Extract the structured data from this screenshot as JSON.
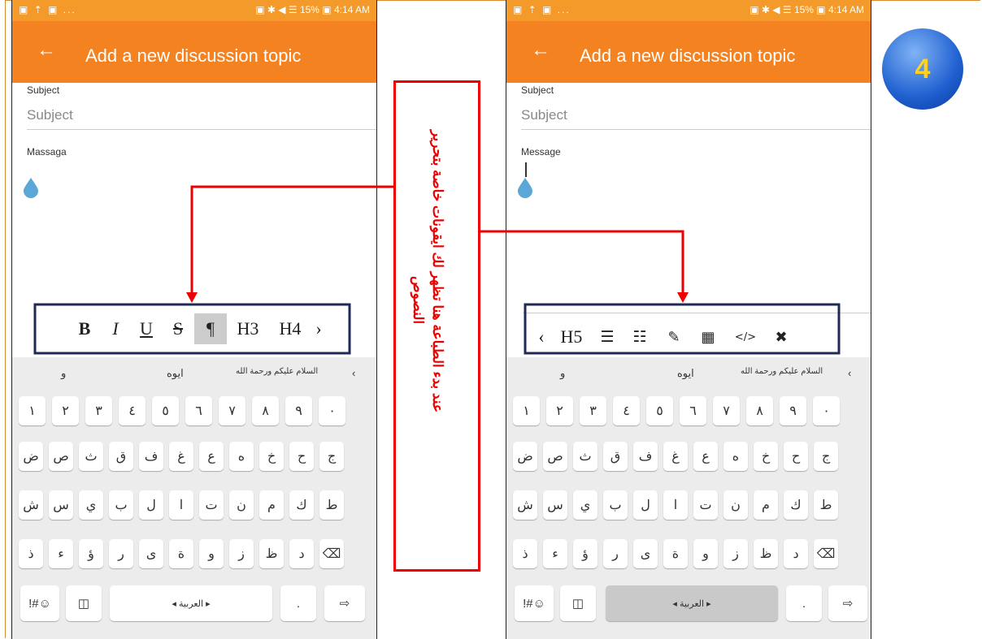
{
  "status_bar": {
    "left_icons": "▣ ⇡ ▣ ...",
    "right_info": "▣ ✱ ◀ ☰ 15% ▣ 4:14 AM"
  },
  "app_bar": {
    "back_icon": "←",
    "title": "Add a new discussion topic"
  },
  "form": {
    "subject_label": "Subject",
    "subject_placeholder": "Subject",
    "message_label_left": "Massaga",
    "message_label_right": "Message"
  },
  "toolbar_left": {
    "buttons": [
      "B",
      "I",
      "U",
      "S",
      "¶",
      "H3",
      "H4"
    ],
    "active_index": 4,
    "more": "›"
  },
  "toolbar_right": {
    "less": "‹",
    "buttons": [
      "H5",
      "☰",
      "☷",
      "✎",
      "▦",
      "</>",
      "✖"
    ]
  },
  "keyboard": {
    "suggestions": [
      "و",
      "ايوه",
      "السلام عليكم ورحمة الله",
      "‹"
    ],
    "digits": [
      "١",
      "٢",
      "٣",
      "٤",
      "٥",
      "٦",
      "٧",
      "٨",
      "٩",
      "٠"
    ],
    "row1": [
      "ض",
      "ص",
      "ث",
      "ق",
      "ف",
      "غ",
      "ع",
      "ه",
      "خ",
      "ح",
      "ج"
    ],
    "row2": [
      "ش",
      "س",
      "ي",
      "ب",
      "ل",
      "ا",
      "ت",
      "ن",
      "م",
      "ك",
      "ط"
    ],
    "row3": [
      "ذ",
      "ء",
      "ؤ",
      "ر",
      "ى",
      "ة",
      "و",
      "ز",
      "ظ",
      "د",
      "⌫"
    ],
    "symbols_key": "!#☺",
    "space_label": "◂ العربية ▸",
    "period_key": ".",
    "enter_key": "⇨"
  },
  "callout": {
    "line1": "عند بدء الطباعة هنا تظهر لك ايقونات خاصة بتحرير",
    "line2": "النصوص"
  },
  "step_badge": "4",
  "colors": {
    "app_bar": "#f58220",
    "status_bar": "#f39a2b",
    "callout": "#e00000",
    "toolbar_frame": "#1f2a55",
    "badge": "#1f5fd0",
    "badge_text": "#ffd21f"
  }
}
